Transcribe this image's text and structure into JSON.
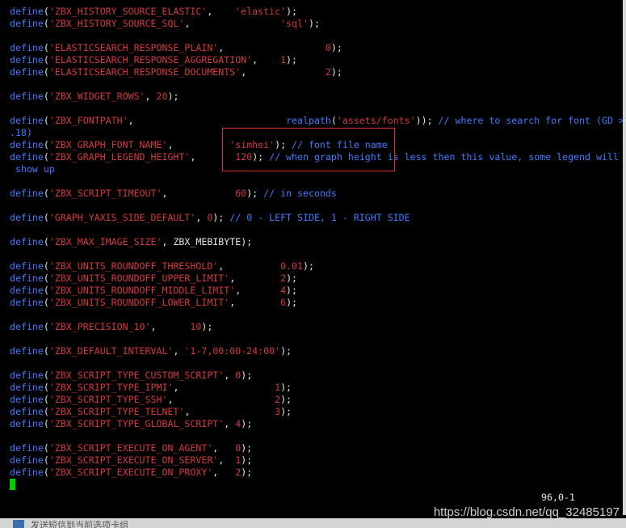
{
  "editor": {
    "lines": [
      [
        [
          "kw",
          "define"
        ],
        [
          "pl",
          "("
        ],
        [
          "str",
          "'ZBX_HISTORY_SOURCE_ELASTIC'"
        ],
        [
          "pl",
          ",    "
        ],
        [
          "str",
          "'elastic'"
        ],
        [
          "pl",
          ");"
        ]
      ],
      [
        [
          "kw",
          "define"
        ],
        [
          "pl",
          "("
        ],
        [
          "str",
          "'ZBX_HISTORY_SOURCE_SQL'"
        ],
        [
          "pl",
          ",                "
        ],
        [
          "str",
          "'sql'"
        ],
        [
          "pl",
          ");"
        ]
      ],
      [],
      [
        [
          "kw",
          "define"
        ],
        [
          "pl",
          "("
        ],
        [
          "str",
          "'ELASTICSEARCH_RESPONSE_PLAIN'"
        ],
        [
          "pl",
          ",                  "
        ],
        [
          "num",
          "0"
        ],
        [
          "pl",
          ");"
        ]
      ],
      [
        [
          "kw",
          "define"
        ],
        [
          "pl",
          "("
        ],
        [
          "str",
          "'ELASTICSEARCH_RESPONSE_AGGREGATION'"
        ],
        [
          "pl",
          ",    "
        ],
        [
          "num",
          "1"
        ],
        [
          "pl",
          ");"
        ]
      ],
      [
        [
          "kw",
          "define"
        ],
        [
          "pl",
          "("
        ],
        [
          "str",
          "'ELASTICSEARCH_RESPONSE_DOCUMENTS'"
        ],
        [
          "pl",
          ",              "
        ],
        [
          "num",
          "2"
        ],
        [
          "pl",
          ");"
        ]
      ],
      [],
      [
        [
          "kw",
          "define"
        ],
        [
          "pl",
          "("
        ],
        [
          "str",
          "'ZBX_WIDGET_ROWS'"
        ],
        [
          "pl",
          ", "
        ],
        [
          "num",
          "20"
        ],
        [
          "pl",
          ");"
        ]
      ],
      [],
      [
        [
          "kw",
          "define"
        ],
        [
          "pl",
          "("
        ],
        [
          "str",
          "'ZBX_FONTPATH'"
        ],
        [
          "pl",
          ",                           "
        ],
        [
          "fn",
          "realpath"
        ],
        [
          "pl",
          "("
        ],
        [
          "str",
          "'assets/fonts'"
        ],
        [
          "pl",
          "));"
        ],
        [
          "cm",
          " // where to search for font (GD >"
        ]
      ],
      [
        [
          "cm",
          ".18)"
        ]
      ],
      [
        [
          "kw",
          "define"
        ],
        [
          "pl",
          "("
        ],
        [
          "str",
          "'ZBX_GRAPH_FONT_NAME'"
        ],
        [
          "pl",
          ",          "
        ],
        [
          "str",
          "'simhei'"
        ],
        [
          "pl",
          ");"
        ],
        [
          "cm",
          " // font file name"
        ]
      ],
      [
        [
          "kw",
          "define"
        ],
        [
          "pl",
          "("
        ],
        [
          "str",
          "'ZBX_GRAPH_LEGEND_HEIGHT'"
        ],
        [
          "pl",
          ",       "
        ],
        [
          "num",
          "120"
        ],
        [
          "pl",
          ");"
        ],
        [
          "cm",
          " // when graph height is less then this value, some legend will"
        ]
      ],
      [
        [
          "cm",
          " show up"
        ]
      ],
      [],
      [
        [
          "kw",
          "define"
        ],
        [
          "pl",
          "("
        ],
        [
          "str",
          "'ZBX_SCRIPT_TIMEOUT'"
        ],
        [
          "pl",
          ",            "
        ],
        [
          "num",
          "60"
        ],
        [
          "pl",
          ");"
        ],
        [
          "cm",
          " // in seconds"
        ]
      ],
      [],
      [
        [
          "kw",
          "define"
        ],
        [
          "pl",
          "("
        ],
        [
          "str",
          "'GRAPH_YAXIS_SIDE_DEFAULT'"
        ],
        [
          "pl",
          ", "
        ],
        [
          "num",
          "0"
        ],
        [
          "pl",
          ");"
        ],
        [
          "cm",
          " // 0 - LEFT SIDE, 1 - RIGHT SIDE"
        ]
      ],
      [],
      [
        [
          "kw",
          "define"
        ],
        [
          "pl",
          "("
        ],
        [
          "str",
          "'ZBX_MAX_IMAGE_SIZE'"
        ],
        [
          "pl",
          ", ZBX_MEBIBYTE);"
        ]
      ],
      [],
      [
        [
          "kw",
          "define"
        ],
        [
          "pl",
          "("
        ],
        [
          "str",
          "'ZBX_UNITS_ROUNDOFF_THRESHOLD'"
        ],
        [
          "pl",
          ",          "
        ],
        [
          "num",
          "0.01"
        ],
        [
          "pl",
          ");"
        ]
      ],
      [
        [
          "kw",
          "define"
        ],
        [
          "pl",
          "("
        ],
        [
          "str",
          "'ZBX_UNITS_ROUNDOFF_UPPER_LIMIT'"
        ],
        [
          "pl",
          ",        "
        ],
        [
          "num",
          "2"
        ],
        [
          "pl",
          ");"
        ]
      ],
      [
        [
          "kw",
          "define"
        ],
        [
          "pl",
          "("
        ],
        [
          "str",
          "'ZBX_UNITS_ROUNDOFF_MIDDLE_LIMIT'"
        ],
        [
          "pl",
          ",       "
        ],
        [
          "num",
          "4"
        ],
        [
          "pl",
          ");"
        ]
      ],
      [
        [
          "kw",
          "define"
        ],
        [
          "pl",
          "("
        ],
        [
          "str",
          "'ZBX_UNITS_ROUNDOFF_LOWER_LIMIT'"
        ],
        [
          "pl",
          ",        "
        ],
        [
          "num",
          "6"
        ],
        [
          "pl",
          ");"
        ]
      ],
      [],
      [
        [
          "kw",
          "define"
        ],
        [
          "pl",
          "("
        ],
        [
          "str",
          "'ZBX_PRECISION_10'"
        ],
        [
          "pl",
          ",      "
        ],
        [
          "num",
          "10"
        ],
        [
          "pl",
          ");"
        ]
      ],
      [],
      [
        [
          "kw",
          "define"
        ],
        [
          "pl",
          "("
        ],
        [
          "str",
          "'ZBX_DEFAULT_INTERVAL'"
        ],
        [
          "pl",
          ", "
        ],
        [
          "str",
          "'1-7,00:00-24:00'"
        ],
        [
          "pl",
          ");"
        ]
      ],
      [],
      [
        [
          "kw",
          "define"
        ],
        [
          "pl",
          "("
        ],
        [
          "str",
          "'ZBX_SCRIPT_TYPE_CUSTOM_SCRIPT'"
        ],
        [
          "pl",
          ", "
        ],
        [
          "num",
          "0"
        ],
        [
          "pl",
          ");"
        ]
      ],
      [
        [
          "kw",
          "define"
        ],
        [
          "pl",
          "("
        ],
        [
          "str",
          "'ZBX_SCRIPT_TYPE_IPMI'"
        ],
        [
          "pl",
          ",                 "
        ],
        [
          "num",
          "1"
        ],
        [
          "pl",
          ");"
        ]
      ],
      [
        [
          "kw",
          "define"
        ],
        [
          "pl",
          "("
        ],
        [
          "str",
          "'ZBX_SCRIPT_TYPE_SSH'"
        ],
        [
          "pl",
          ",                  "
        ],
        [
          "num",
          "2"
        ],
        [
          "pl",
          ");"
        ]
      ],
      [
        [
          "kw",
          "define"
        ],
        [
          "pl",
          "("
        ],
        [
          "str",
          "'ZBX_SCRIPT_TYPE_TELNET'"
        ],
        [
          "pl",
          ",               "
        ],
        [
          "num",
          "3"
        ],
        [
          "pl",
          ");"
        ]
      ],
      [
        [
          "kw",
          "define"
        ],
        [
          "pl",
          "("
        ],
        [
          "str",
          "'ZBX_SCRIPT_TYPE_GLOBAL_SCRIPT'"
        ],
        [
          "pl",
          ", "
        ],
        [
          "num",
          "4"
        ],
        [
          "pl",
          ");"
        ]
      ],
      [],
      [
        [
          "kw",
          "define"
        ],
        [
          "pl",
          "("
        ],
        [
          "str",
          "'ZBX_SCRIPT_EXECUTE_ON_AGENT'"
        ],
        [
          "pl",
          ",   "
        ],
        [
          "num",
          "0"
        ],
        [
          "pl",
          ");"
        ]
      ],
      [
        [
          "kw",
          "define"
        ],
        [
          "pl",
          "("
        ],
        [
          "str",
          "'ZBX_SCRIPT_EXECUTE_ON_SERVER'"
        ],
        [
          "pl",
          ",  "
        ],
        [
          "num",
          "1"
        ],
        [
          "pl",
          ");"
        ]
      ],
      [
        [
          "kw",
          "define"
        ],
        [
          "pl",
          "("
        ],
        [
          "str",
          "'ZBX_SCRIPT_EXECUTE_ON_PROXY'"
        ],
        [
          "pl",
          ",   "
        ],
        [
          "num",
          "2"
        ],
        [
          "pl",
          ");"
        ]
      ],
      [
        [
          "cursor",
          ""
        ]
      ]
    ]
  },
  "statusline": {
    "position": "96,0-1"
  },
  "watermark": {
    "text": "https://blog.csdn.net/qq_32485197"
  },
  "bottom_bar": {
    "text": "发送短信到当前选项卡组"
  },
  "colors": {
    "keyword": "#3f7bff",
    "string": "#d23a3a",
    "comment": "#3f7bff",
    "cursor": "#00d000",
    "highlight_box": "#e03030",
    "background": "#000000"
  }
}
